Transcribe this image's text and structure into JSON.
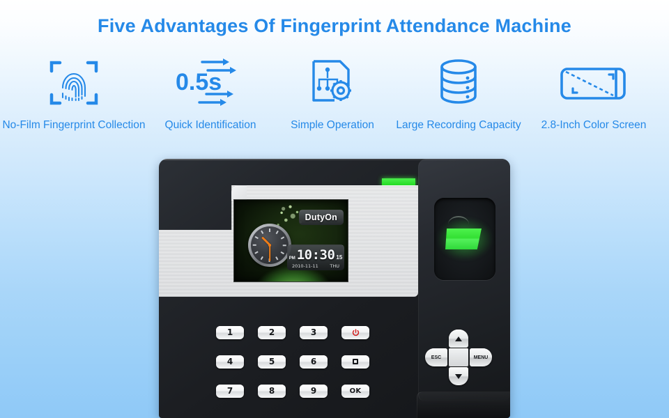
{
  "page": {
    "title": "Five Advantages Of Fingerprint Attendance Machine",
    "accent_color": "#2589e8",
    "background_top": "#ffffff",
    "background_bottom": "#8fc9f7"
  },
  "features": [
    {
      "icon": "fingerprint-scan-icon",
      "label": "No-Film Fingerprint Collection"
    },
    {
      "icon": "speed-arrows-icon",
      "value": "0.5s",
      "label": "Quick Identification"
    },
    {
      "icon": "document-flowchart-gear-icon",
      "label": "Simple Operation"
    },
    {
      "icon": "database-cylinder-icon",
      "label": "Large Recording Capacity"
    },
    {
      "icon": "screen-diagonal-icon",
      "label": "2.8-Inch Color Screen"
    }
  ],
  "device": {
    "name": "fingerprint-attendance-machine",
    "led_color": "#2bdb2b",
    "sensor_color": "#33e033",
    "screen": {
      "mode_badge": "DutyOn",
      "ampm": "PM",
      "time": "10:30",
      "seconds": "15",
      "date": "2010-11-11",
      "weekday": "THU",
      "clock_hour_angle": -45,
      "clock_minute_angle": 180
    },
    "keypad": [
      {
        "label": "1",
        "type": "digit"
      },
      {
        "label": "2",
        "type": "digit"
      },
      {
        "label": "3",
        "type": "digit"
      },
      {
        "label": "",
        "type": "power"
      },
      {
        "label": "4",
        "type": "digit"
      },
      {
        "label": "5",
        "type": "digit"
      },
      {
        "label": "6",
        "type": "digit"
      },
      {
        "label": "",
        "type": "stop"
      },
      {
        "label": "7",
        "type": "digit"
      },
      {
        "label": "8",
        "type": "digit"
      },
      {
        "label": "9",
        "type": "digit"
      },
      {
        "label": "OK",
        "type": "ok"
      }
    ],
    "navpad": {
      "up": "",
      "down": "",
      "left": "ESC",
      "right": "MENU",
      "center": ""
    }
  }
}
